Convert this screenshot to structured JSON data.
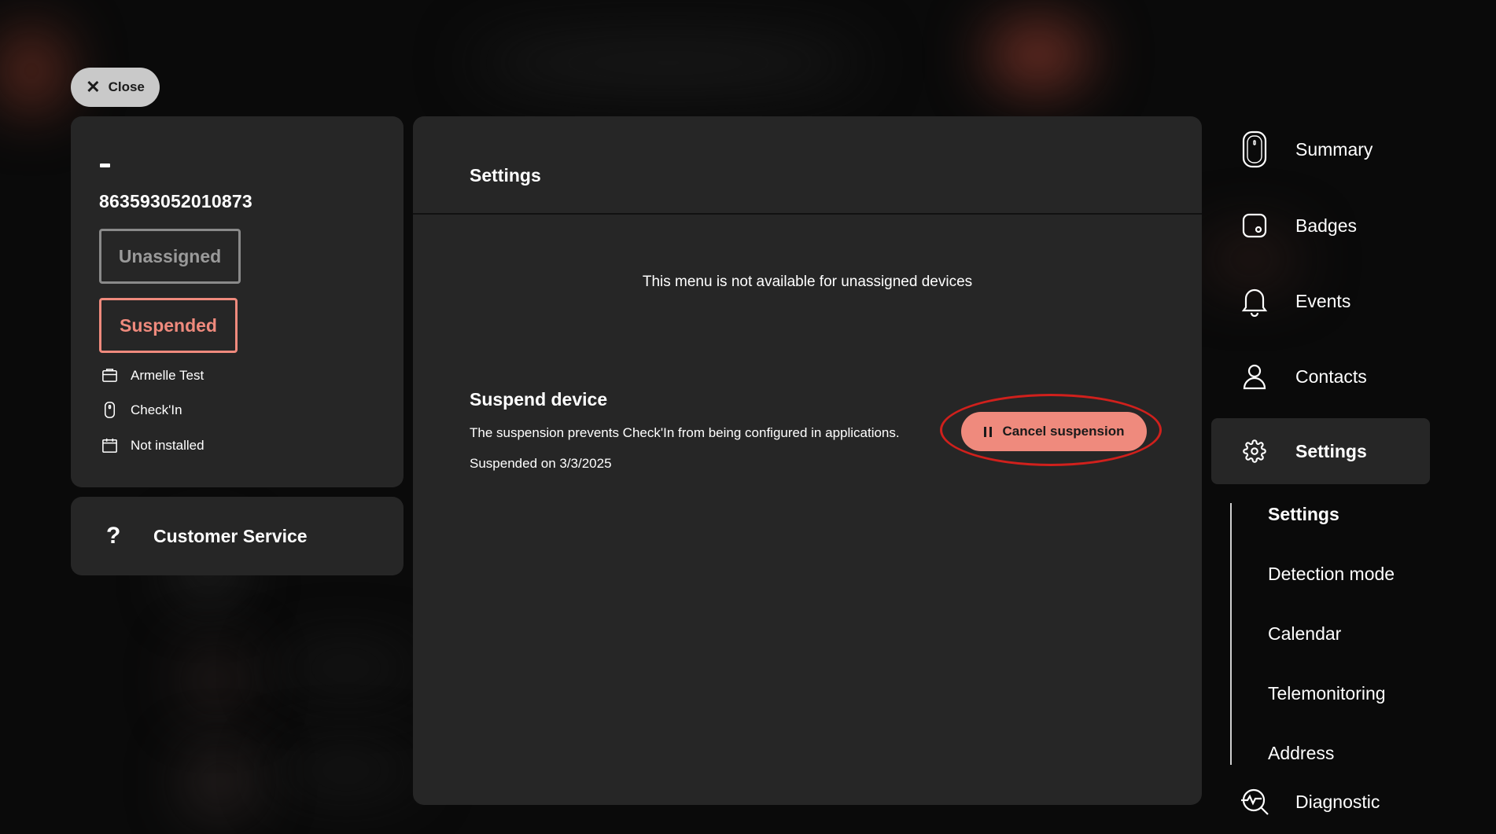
{
  "close_button": {
    "label": "Close"
  },
  "device": {
    "name": "-",
    "id": "863593052010873",
    "status_tags": [
      "Unassigned",
      "Suspended"
    ],
    "info": [
      {
        "icon": "briefcase-icon",
        "text": "Armelle Test"
      },
      {
        "icon": "device-icon",
        "text": "Check'In"
      },
      {
        "icon": "calendar-icon",
        "text": "Not installed"
      }
    ]
  },
  "customer_service": {
    "icon": "?",
    "label": "Customer Service"
  },
  "main": {
    "title": "Settings",
    "notice": "This menu is not available for unassigned devices",
    "suspend": {
      "title": "Suspend device",
      "description": "The suspension prevents Check'In from being configured in applications.",
      "date": "Suspended on 3/3/2025",
      "button_label": "Cancel suspension"
    }
  },
  "nav": {
    "items": [
      {
        "label": "Summary",
        "icon": "device-icon"
      },
      {
        "label": "Badges",
        "icon": "badge-icon"
      },
      {
        "label": "Events",
        "icon": "bell-icon"
      },
      {
        "label": "Contacts",
        "icon": "person-icon"
      },
      {
        "label": "Settings",
        "icon": "gear-icon"
      }
    ],
    "sub_items": [
      "Settings",
      "Detection mode",
      "Calendar",
      "Telemonitoring",
      "Address"
    ],
    "diagnostic": {
      "label": "Diagnostic",
      "icon": "diagnostic-icon"
    }
  },
  "colors": {
    "accent": "#ef8a7d",
    "panel": "#262626",
    "highlight": "#d0201c"
  }
}
